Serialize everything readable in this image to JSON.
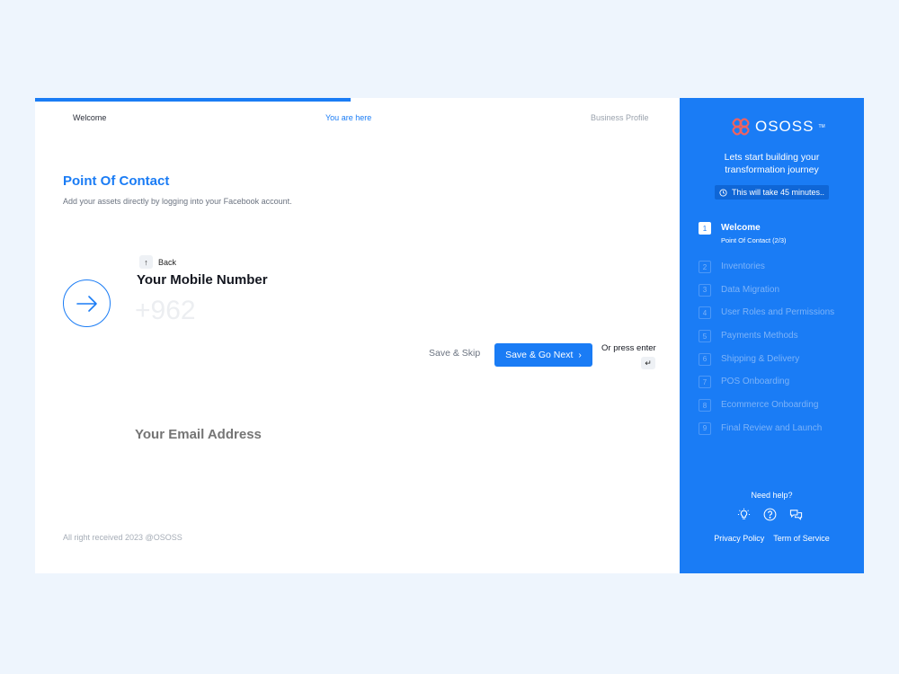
{
  "nav": {
    "welcome": "Welcome",
    "you_are_here": "You are here",
    "business_profile": "Business Profile",
    "progress": 0.49
  },
  "main": {
    "title": "Point Of Contact",
    "subtitle": "Add your assets directly by logging into your Facebook account.",
    "back_label": "Back",
    "question": "Your Mobile Number",
    "phone_value": "+962",
    "save_skip": "Save & Skip",
    "save_next": "Save & Go Next",
    "press_enter": "Or press enter",
    "email_placeholder": "Your Email Address",
    "copyright": "All right received 2023 @OSOSS"
  },
  "sidebar": {
    "brand": "OSOSS",
    "tm": "TM",
    "tagline_line1": "Lets start building your",
    "tagline_line2": "transformation journey",
    "time_note": "This will take 45 minutes..",
    "steps": [
      {
        "num": "1",
        "label": "Welcome",
        "sub": "Point Of Contact (2/3)"
      },
      {
        "num": "2",
        "label": "Inventories"
      },
      {
        "num": "3",
        "label": "Data Migration"
      },
      {
        "num": "4",
        "label": "User Roles and Permissions"
      },
      {
        "num": "5",
        "label": "Payments Methods"
      },
      {
        "num": "6",
        "label": "Shipping & Delivery"
      },
      {
        "num": "7",
        "label": "POS Onboarding"
      },
      {
        "num": "8",
        "label": "Ecommerce Onboarding"
      },
      {
        "num": "9",
        "label": "Final Review and Launch"
      }
    ],
    "need_help": "Need help?",
    "privacy": "Privacy Policy",
    "terms": "Term of Service"
  },
  "colors": {
    "accent": "#1a7cf5",
    "background": "#eef5fd",
    "logo": "#f0625f"
  },
  "icons": [
    "arrow-right-icon",
    "arrow-up-icon",
    "clock-icon",
    "lightbulb-icon",
    "question-icon",
    "chat-icon",
    "enter-key-icon",
    "chevron-right-icon"
  ]
}
